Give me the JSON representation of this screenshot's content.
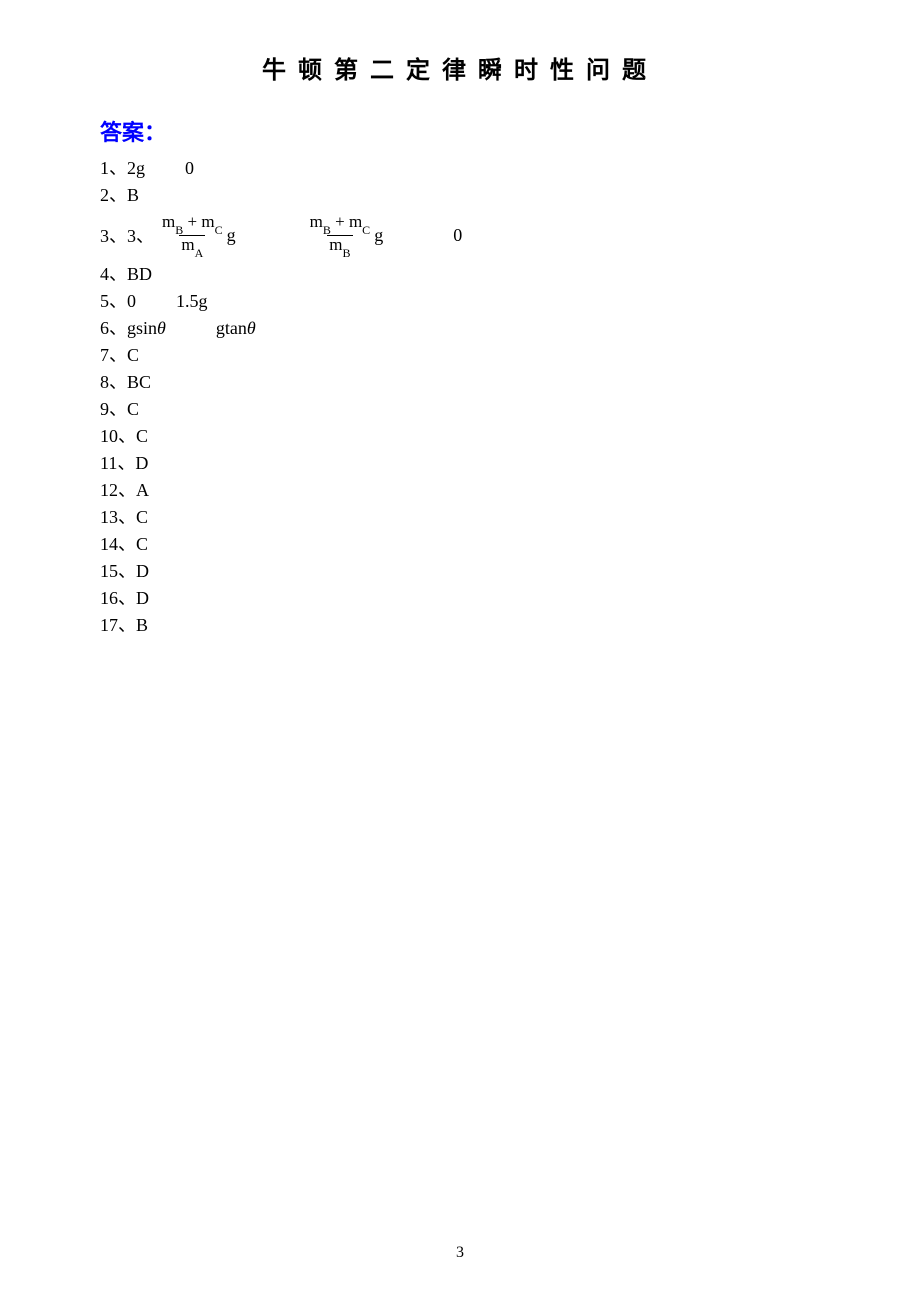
{
  "title": "牛顿第二定律瞬时性问题",
  "section_heading": "答案：",
  "answers": {
    "a1": {
      "num": "1、",
      "val1": "2g",
      "val2": "0"
    },
    "a2": {
      "num": "2、",
      "val": "B"
    },
    "a3": {
      "num": "3、",
      "extra": "3、",
      "frac1_num_m1": "m",
      "frac1_num_s1": "B",
      "frac1_num_plus": " + ",
      "frac1_num_m2": "m",
      "frac1_num_s2": "C",
      "frac1_den_m": "m",
      "frac1_den_s": "A",
      "g": "g",
      "frac2_num_m1": "m",
      "frac2_num_s1": "B",
      "frac2_num_plus": " + ",
      "frac2_num_m2": "m",
      "frac2_num_s2": "C",
      "frac2_den_m": "m",
      "frac2_den_s": "B",
      "val3": "0"
    },
    "a4": {
      "num": "4、",
      "val": "BD"
    },
    "a5": {
      "num": "5、",
      "val1": "0",
      "val2": "1.5g"
    },
    "a6": {
      "num": "6、",
      "val1_prefix": "gsin",
      "val1_theta": "θ",
      "val2_prefix": "gtan",
      "val2_theta": "θ"
    },
    "a7": {
      "num": "7、",
      "val": "C"
    },
    "a8": {
      "num": "8、",
      "val": "BC"
    },
    "a9": {
      "num": "9、",
      "val": "C"
    },
    "a10": {
      "num": "10、",
      "val": "C"
    },
    "a11": {
      "num": "11、",
      "val": "D"
    },
    "a12": {
      "num": "12、",
      "val": "A"
    },
    "a13": {
      "num": "13、",
      "val": "C"
    },
    "a14": {
      "num": "14、",
      "val": "C"
    },
    "a15": {
      "num": "15、",
      "val": "D"
    },
    "a16": {
      "num": "16、",
      "val": "D"
    },
    "a17": {
      "num": "17、",
      "val": "B"
    }
  },
  "page_number": "3"
}
